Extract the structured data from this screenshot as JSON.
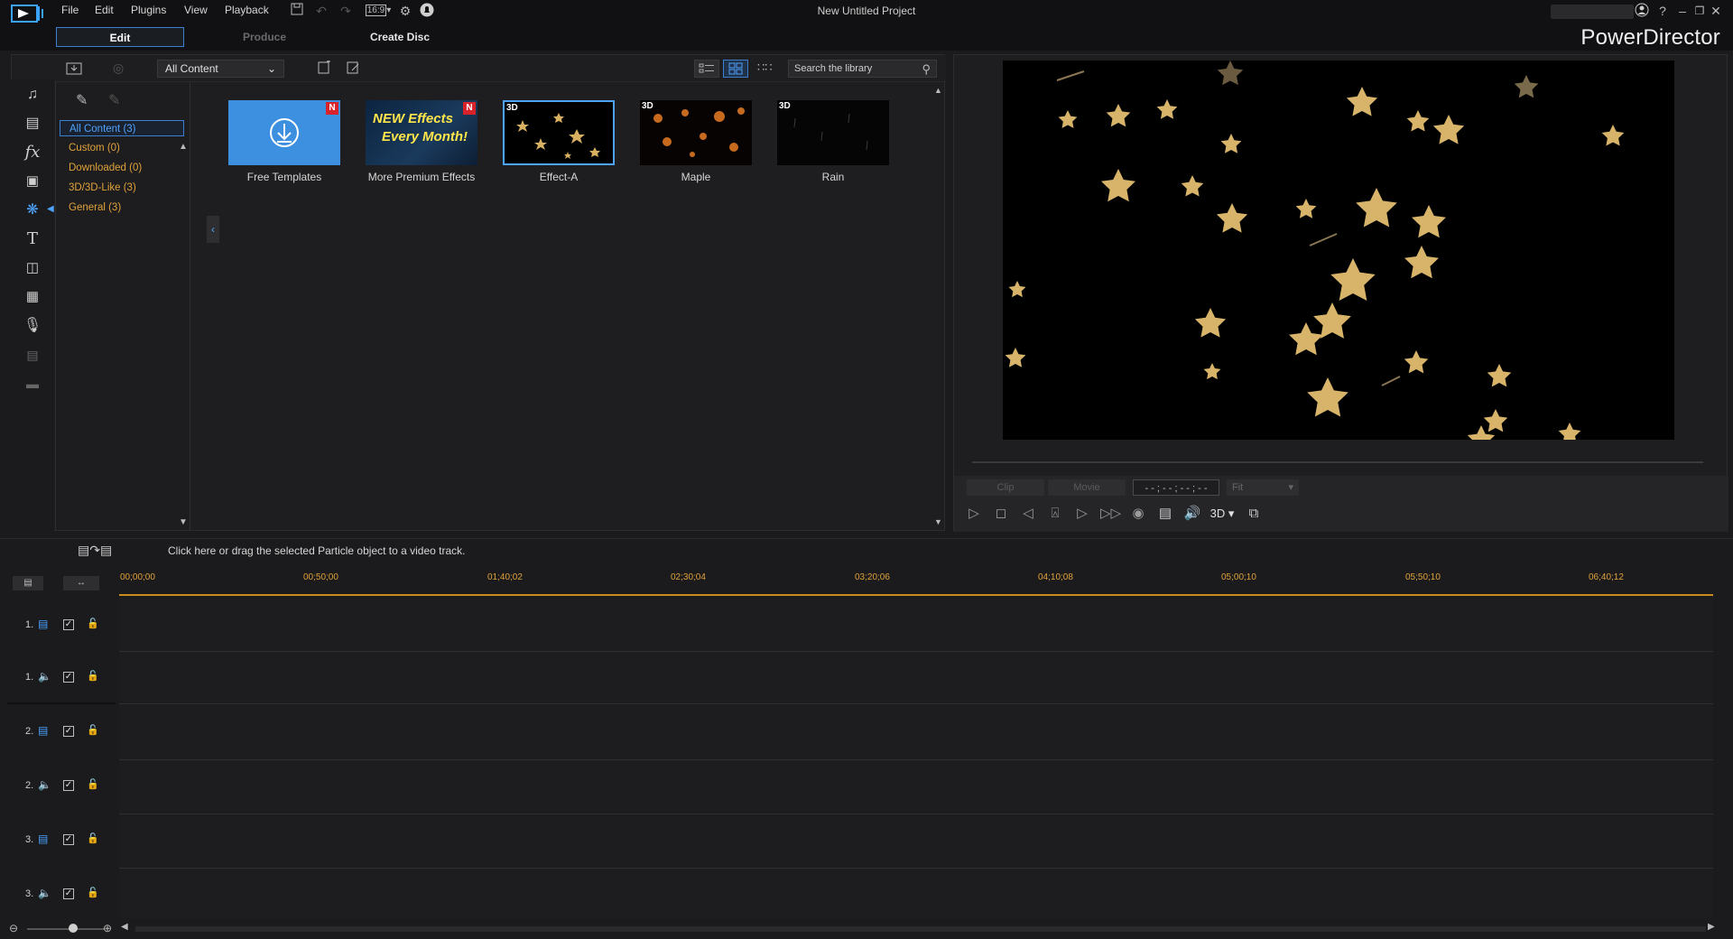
{
  "titlebar": {
    "menus": [
      "File",
      "Edit",
      "Plugins",
      "View",
      "Playback"
    ],
    "aspect_ratio": "16:9",
    "project_title": "New Untitled Project",
    "window_controls": [
      "account-icon",
      "help-icon",
      "minimize-icon",
      "restore-icon",
      "close-icon"
    ]
  },
  "modes": {
    "edit": "Edit",
    "produce": "Produce",
    "create_disc": "Create Disc",
    "brand": "PowerDirector"
  },
  "rooms": [
    "media-room-icon",
    "template-room-icon",
    "fx-room-icon",
    "pip-room-icon",
    "particle-room-icon",
    "title-room-icon",
    "transition-room-icon",
    "audio-mixing-room-icon",
    "voice-over-icon",
    "chapter-room-icon",
    "subtitle-room-icon"
  ],
  "library": {
    "content_filter": "All Content",
    "search_placeholder": "Search the library",
    "categories": [
      {
        "label": "All Content  (3)",
        "selected": true
      },
      {
        "label": "Custom  (0)",
        "selected": false
      },
      {
        "label": "Downloaded  (0)",
        "selected": false
      },
      {
        "label": "3D/3D-Like  (3)",
        "selected": false
      },
      {
        "label": "General  (3)",
        "selected": false
      }
    ],
    "items": [
      {
        "label": "Free Templates",
        "badge": "N",
        "badge3d": ""
      },
      {
        "label": "More Premium Effects",
        "badge": "N",
        "badge3d": "",
        "banner_line1": "NEW Effects",
        "banner_line2": "Every Month!"
      },
      {
        "label": "Effect-A",
        "badge": "",
        "badge3d": "3D",
        "selected": true
      },
      {
        "label": "Maple",
        "badge": "",
        "badge3d": "3D"
      },
      {
        "label": "Rain",
        "badge": "",
        "badge3d": "3D"
      }
    ]
  },
  "preview": {
    "clip_label": "Clip",
    "movie_label": "Movie",
    "timecode": "- - ; - - ; - - ; - -",
    "fit_label": "Fit",
    "mode_3d": "3D"
  },
  "timeline": {
    "hint": "Click here or drag the selected Particle object to a video track.",
    "ruler_labels": [
      "00;00;00",
      "00;50;00",
      "01;40;02",
      "02;30;04",
      "03;20;06",
      "04;10;08",
      "05;00;10",
      "05;50;10",
      "06;40;12"
    ],
    "tracks": [
      {
        "number": "1.",
        "type": "video"
      },
      {
        "number": "1.",
        "type": "audio"
      },
      {
        "number": "2.",
        "type": "video"
      },
      {
        "number": "2.",
        "type": "audio"
      },
      {
        "number": "3.",
        "type": "video"
      },
      {
        "number": "3.",
        "type": "audio"
      }
    ]
  },
  "colors": {
    "accent_blue": "#3a7fd0",
    "category_orange": "#e0a23a",
    "ruler_gold": "#c98d1c",
    "badge_red": "#d8232a"
  }
}
